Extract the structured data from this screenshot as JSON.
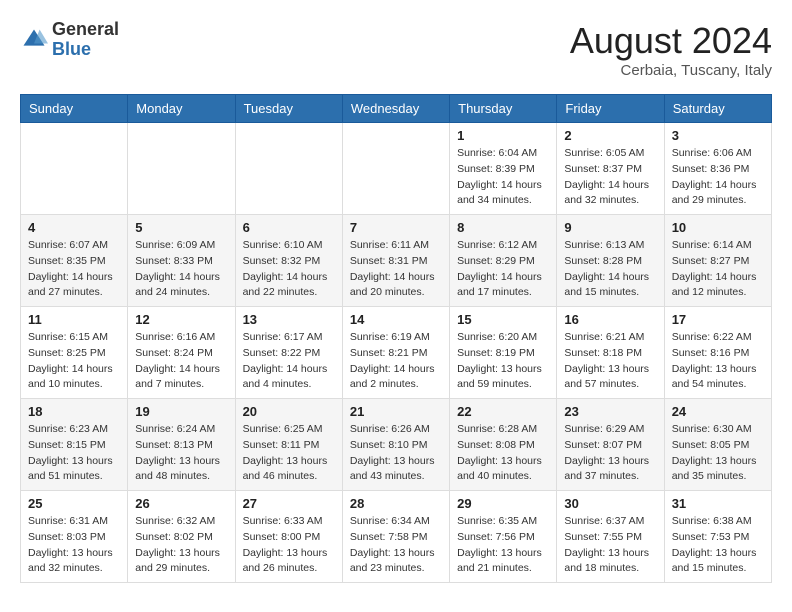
{
  "logo": {
    "general": "General",
    "blue": "Blue"
  },
  "title": {
    "month_year": "August 2024",
    "location": "Cerbaia, Tuscany, Italy"
  },
  "days_of_week": [
    "Sunday",
    "Monday",
    "Tuesday",
    "Wednesday",
    "Thursday",
    "Friday",
    "Saturday"
  ],
  "weeks": [
    [
      {
        "day": "",
        "info": ""
      },
      {
        "day": "",
        "info": ""
      },
      {
        "day": "",
        "info": ""
      },
      {
        "day": "",
        "info": ""
      },
      {
        "day": "1",
        "info": "Sunrise: 6:04 AM\nSunset: 8:39 PM\nDaylight: 14 hours\nand 34 minutes."
      },
      {
        "day": "2",
        "info": "Sunrise: 6:05 AM\nSunset: 8:37 PM\nDaylight: 14 hours\nand 32 minutes."
      },
      {
        "day": "3",
        "info": "Sunrise: 6:06 AM\nSunset: 8:36 PM\nDaylight: 14 hours\nand 29 minutes."
      }
    ],
    [
      {
        "day": "4",
        "info": "Sunrise: 6:07 AM\nSunset: 8:35 PM\nDaylight: 14 hours\nand 27 minutes."
      },
      {
        "day": "5",
        "info": "Sunrise: 6:09 AM\nSunset: 8:33 PM\nDaylight: 14 hours\nand 24 minutes."
      },
      {
        "day": "6",
        "info": "Sunrise: 6:10 AM\nSunset: 8:32 PM\nDaylight: 14 hours\nand 22 minutes."
      },
      {
        "day": "7",
        "info": "Sunrise: 6:11 AM\nSunset: 8:31 PM\nDaylight: 14 hours\nand 20 minutes."
      },
      {
        "day": "8",
        "info": "Sunrise: 6:12 AM\nSunset: 8:29 PM\nDaylight: 14 hours\nand 17 minutes."
      },
      {
        "day": "9",
        "info": "Sunrise: 6:13 AM\nSunset: 8:28 PM\nDaylight: 14 hours\nand 15 minutes."
      },
      {
        "day": "10",
        "info": "Sunrise: 6:14 AM\nSunset: 8:27 PM\nDaylight: 14 hours\nand 12 minutes."
      }
    ],
    [
      {
        "day": "11",
        "info": "Sunrise: 6:15 AM\nSunset: 8:25 PM\nDaylight: 14 hours\nand 10 minutes."
      },
      {
        "day": "12",
        "info": "Sunrise: 6:16 AM\nSunset: 8:24 PM\nDaylight: 14 hours\nand 7 minutes."
      },
      {
        "day": "13",
        "info": "Sunrise: 6:17 AM\nSunset: 8:22 PM\nDaylight: 14 hours\nand 4 minutes."
      },
      {
        "day": "14",
        "info": "Sunrise: 6:19 AM\nSunset: 8:21 PM\nDaylight: 14 hours\nand 2 minutes."
      },
      {
        "day": "15",
        "info": "Sunrise: 6:20 AM\nSunset: 8:19 PM\nDaylight: 13 hours\nand 59 minutes."
      },
      {
        "day": "16",
        "info": "Sunrise: 6:21 AM\nSunset: 8:18 PM\nDaylight: 13 hours\nand 57 minutes."
      },
      {
        "day": "17",
        "info": "Sunrise: 6:22 AM\nSunset: 8:16 PM\nDaylight: 13 hours\nand 54 minutes."
      }
    ],
    [
      {
        "day": "18",
        "info": "Sunrise: 6:23 AM\nSunset: 8:15 PM\nDaylight: 13 hours\nand 51 minutes."
      },
      {
        "day": "19",
        "info": "Sunrise: 6:24 AM\nSunset: 8:13 PM\nDaylight: 13 hours\nand 48 minutes."
      },
      {
        "day": "20",
        "info": "Sunrise: 6:25 AM\nSunset: 8:11 PM\nDaylight: 13 hours\nand 46 minutes."
      },
      {
        "day": "21",
        "info": "Sunrise: 6:26 AM\nSunset: 8:10 PM\nDaylight: 13 hours\nand 43 minutes."
      },
      {
        "day": "22",
        "info": "Sunrise: 6:28 AM\nSunset: 8:08 PM\nDaylight: 13 hours\nand 40 minutes."
      },
      {
        "day": "23",
        "info": "Sunrise: 6:29 AM\nSunset: 8:07 PM\nDaylight: 13 hours\nand 37 minutes."
      },
      {
        "day": "24",
        "info": "Sunrise: 6:30 AM\nSunset: 8:05 PM\nDaylight: 13 hours\nand 35 minutes."
      }
    ],
    [
      {
        "day": "25",
        "info": "Sunrise: 6:31 AM\nSunset: 8:03 PM\nDaylight: 13 hours\nand 32 minutes."
      },
      {
        "day": "26",
        "info": "Sunrise: 6:32 AM\nSunset: 8:02 PM\nDaylight: 13 hours\nand 29 minutes."
      },
      {
        "day": "27",
        "info": "Sunrise: 6:33 AM\nSunset: 8:00 PM\nDaylight: 13 hours\nand 26 minutes."
      },
      {
        "day": "28",
        "info": "Sunrise: 6:34 AM\nSunset: 7:58 PM\nDaylight: 13 hours\nand 23 minutes."
      },
      {
        "day": "29",
        "info": "Sunrise: 6:35 AM\nSunset: 7:56 PM\nDaylight: 13 hours\nand 21 minutes."
      },
      {
        "day": "30",
        "info": "Sunrise: 6:37 AM\nSunset: 7:55 PM\nDaylight: 13 hours\nand 18 minutes."
      },
      {
        "day": "31",
        "info": "Sunrise: 6:38 AM\nSunset: 7:53 PM\nDaylight: 13 hours\nand 15 minutes."
      }
    ]
  ]
}
